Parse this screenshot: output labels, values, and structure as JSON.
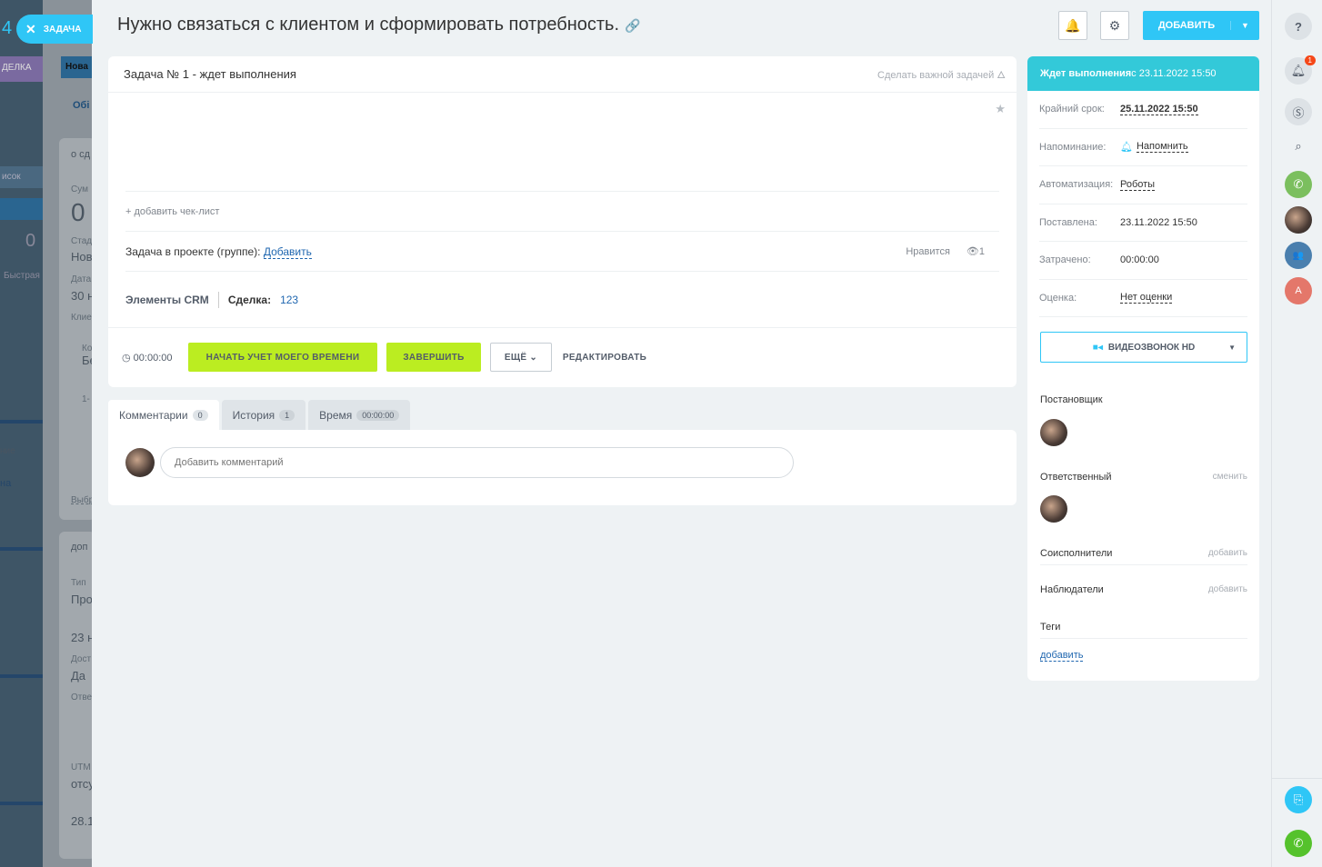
{
  "background": {
    "fragments": [
      "4",
      "ДЕЛКА",
      "Нова",
      "Обі",
      "о сд",
      "Сум",
      "0",
      "Стад",
      "Нов",
      "Дата",
      "30 н",
      "Клие",
      "Ко",
      "Бе",
      "1-",
      "исок",
      "0",
      "Быстрая",
      "ние",
      "на",
      "доп",
      "Тип",
      "Про",
      "23 н",
      "Дост",
      "Да",
      "Отве",
      "UTM",
      "отсу",
      "28.1",
      "Выбр"
    ]
  },
  "close_pill": {
    "label": "ЗАДАЧА"
  },
  "header": {
    "title": "Нужно связаться с клиентом и сформировать потребность.",
    "add_label": "ДОБАВИТЬ"
  },
  "task": {
    "head": "Задача № 1 - ждет выполнения",
    "make_important": "Сделать важной задачей",
    "add_checklist": "+ добавить чек-лист",
    "project_label": "Задача в проекте (группе):",
    "project_add": "Добавить",
    "likes": "Нравится",
    "views": "1",
    "crm_label": "Элементы CRM",
    "deal_label": "Сделка:",
    "deal_value": "123",
    "timer": "00:00:00",
    "btn_start": "НАЧАТЬ УЧЕТ МОЕГО ВРЕМЕНИ",
    "btn_finish": "ЗАВЕРШИТЬ",
    "btn_more": "ЕЩЁ",
    "btn_edit": "РЕДАКТИРОВАТЬ"
  },
  "tabs": [
    {
      "label": "Комментарии",
      "count": "0"
    },
    {
      "label": "История",
      "count": "1"
    },
    {
      "label": "Время",
      "count": "00:00:00"
    }
  ],
  "comment": {
    "placeholder": "Добавить комментарий"
  },
  "sidebar": {
    "status_bold": "Ждет выполнения",
    "status_rest": " с 23.11.2022 15:50",
    "rows": [
      {
        "label": "Крайний срок:",
        "value": "25.11.2022 15:50"
      },
      {
        "label": "Напоминание:",
        "value": "Напомнить"
      },
      {
        "label": "Автоматизация:",
        "value": "Роботы"
      },
      {
        "label": "Поставлена:",
        "value": "23.11.2022 15:50"
      },
      {
        "label": "Затрачено:",
        "value": "00:00:00"
      },
      {
        "label": "Оценка:",
        "value": "Нет оценки"
      }
    ],
    "video_btn": "ВИДЕОЗВОНОК HD",
    "creator": "Постановщик",
    "responsible": "Ответственный",
    "change": "сменить",
    "accomplices": "Соисполнители",
    "watchers": "Наблюдатели",
    "add": "добавить",
    "tags": "Теги",
    "tags_add": "добавить"
  },
  "right_bar": {
    "notif_count": "1",
    "user_initial": "A"
  },
  "colors": {
    "accent": "#2fc6f6",
    "green": "#bbed21",
    "status": "#33c9d9"
  }
}
